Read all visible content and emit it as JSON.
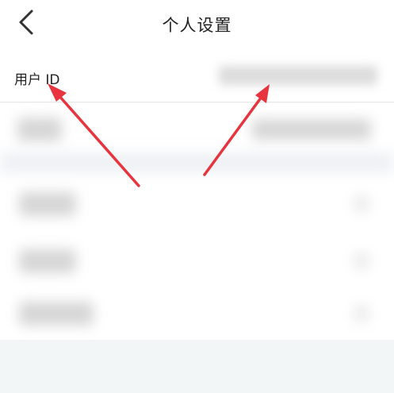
{
  "header": {
    "title": "个人设置",
    "back_icon": "chevron-left-icon"
  },
  "user_id_row": {
    "label": "用户 ID"
  },
  "colors": {
    "arrow": "#e8343f",
    "background": "#f4f6f7",
    "card": "#ffffff"
  },
  "annotations": {
    "arrow_count": 2
  }
}
